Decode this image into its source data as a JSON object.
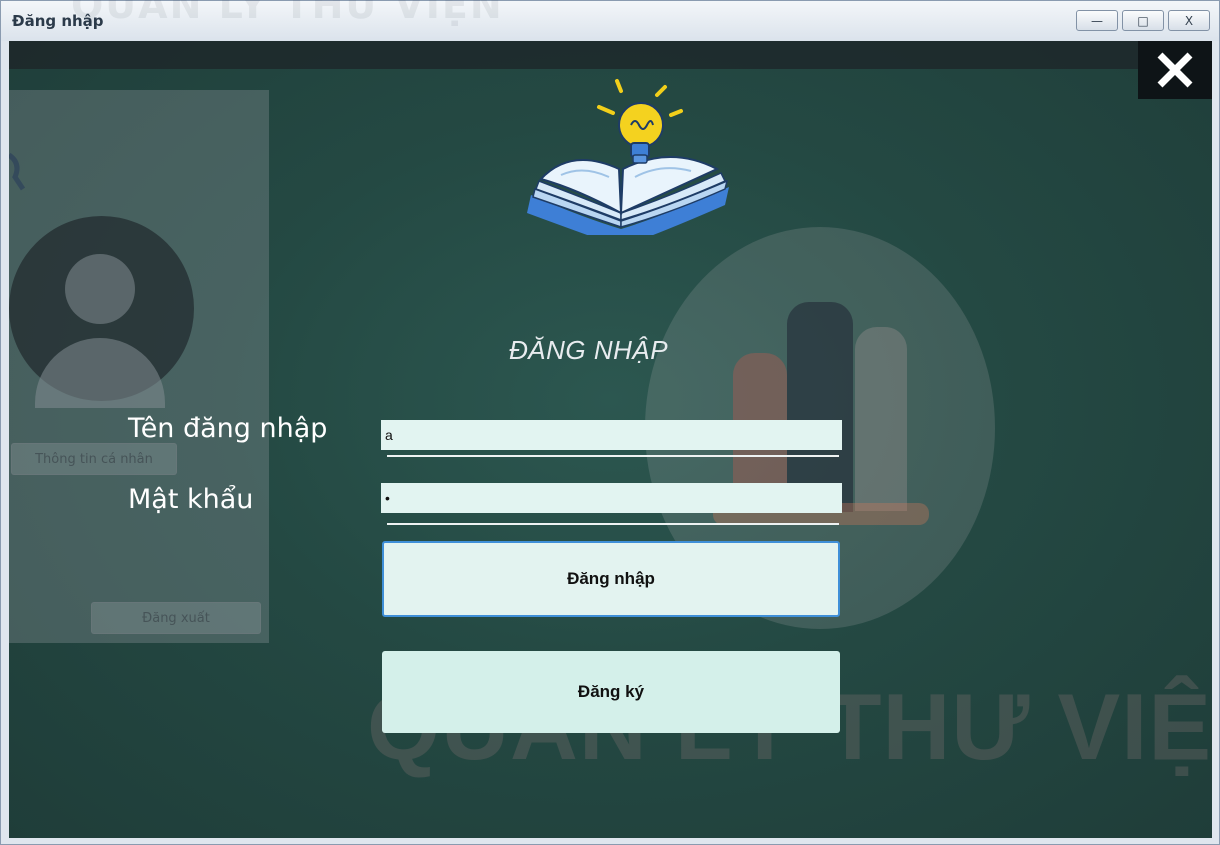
{
  "window": {
    "title": "Đăng nhập",
    "ghost_title": "QUẢN LÝ THƯ VIỆN",
    "minimize_glyph": "—",
    "maximize_glyph": "□",
    "close_glyph": "X"
  },
  "background": {
    "profile_button": "Thông tin cá nhân",
    "logout_button": "Đăng xuất",
    "watermark": "QUẢN LÝ THƯ VIỆN"
  },
  "form": {
    "heading": "ĐĂNG NHẬP",
    "username_label": "Tên đăng nhập",
    "username_value": "a",
    "password_label": "Mật khẩu",
    "password_value": "•",
    "login_button": "Đăng nhập",
    "register_button": "Đăng ký"
  },
  "icons": {
    "close": "close-icon",
    "logo": "book-lightbulb-icon",
    "avatar": "user-avatar-icon"
  },
  "colors": {
    "background": "#244943",
    "field": "#e2f4f1",
    "button": "#d4f0ea",
    "focus_border": "#3f8fd8",
    "bulb": "#f4d21f"
  }
}
